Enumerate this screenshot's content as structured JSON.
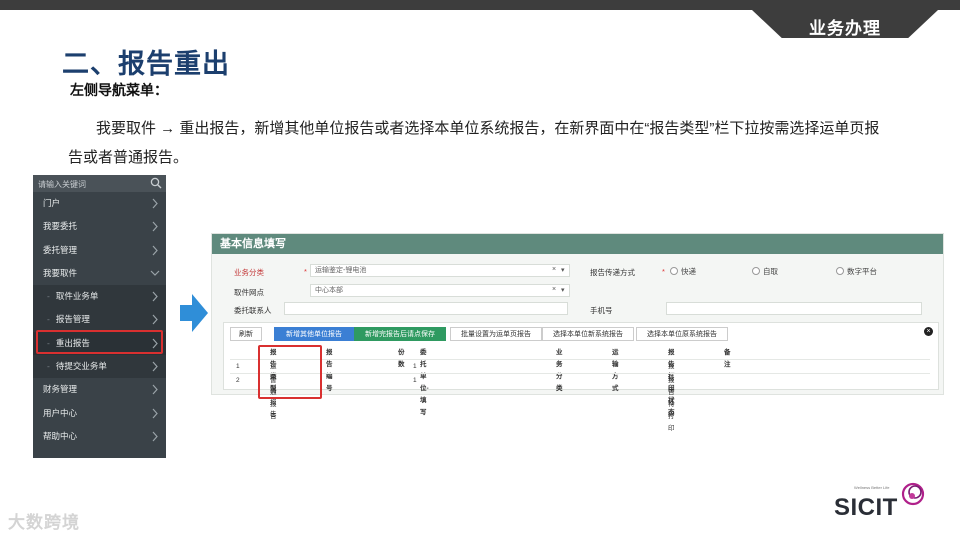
{
  "header": {
    "tag_label": "业务办理"
  },
  "title": "二、报告重出",
  "subtitle": "左侧导航菜单：",
  "paragraph": "我要取件 → 重出报告，新增其他单位报告或者选择本单位系统报告，在新界面中在“报告类型”栏下拉按需选择运单页报告或者普通报告。",
  "nav": {
    "search_placeholder": "请输入关键词",
    "items": [
      {
        "label": "门户",
        "sub": false
      },
      {
        "label": "我要委托",
        "sub": false
      },
      {
        "label": "委托管理",
        "sub": false
      },
      {
        "label": "我要取件",
        "sub": false,
        "expanded": true
      },
      {
        "label": "取件业务单",
        "sub": true
      },
      {
        "label": "报告管理",
        "sub": true
      },
      {
        "label": "重出报告",
        "sub": true,
        "active": true
      },
      {
        "label": "待提交业务单",
        "sub": true
      },
      {
        "label": "财务管理",
        "sub": false
      },
      {
        "label": "用户中心",
        "sub": false
      },
      {
        "label": "帮助中心",
        "sub": false
      }
    ]
  },
  "form": {
    "header": "基本信息填写",
    "business_type_label": "业务分类",
    "business_type_value": "运输鉴定-锂电池",
    "delivery_label": "报告传递方式",
    "delivery_options": [
      "快递",
      "自取",
      "数字平台"
    ],
    "pickup_label": "取件网点",
    "pickup_value": "中心本部",
    "contact_label": "委托联系人",
    "phone_label": "手机号",
    "clear_mark": "×",
    "dropdown_mark": "▾",
    "buttons": {
      "refresh": "刷新",
      "add_other": "新增其他单位报告",
      "add_save": "新增完报告后请点保存",
      "batch": "批量设置为运单页报告",
      "select_new": "选择本单位新系统报告",
      "select_old": "选择本单位原系统报告"
    },
    "table": {
      "headers": [
        "报告类型",
        "报告编号",
        "份数",
        "委托单位-填写",
        "业务分类",
        "运输方式",
        "报告打印状态",
        "备注"
      ],
      "rows": [
        {
          "index": "1",
          "type": "运单页报告",
          "copies": "1",
          "status": "报告待打印"
        },
        {
          "index": "2",
          "type": "普通报告",
          "copies": "1",
          "status": "报告待打印"
        }
      ]
    }
  },
  "logo": {
    "text": "SICIT",
    "tagline": "Wellness Better Life",
    "accent_color": "#b0208a"
  },
  "watermark": "大数跨境"
}
